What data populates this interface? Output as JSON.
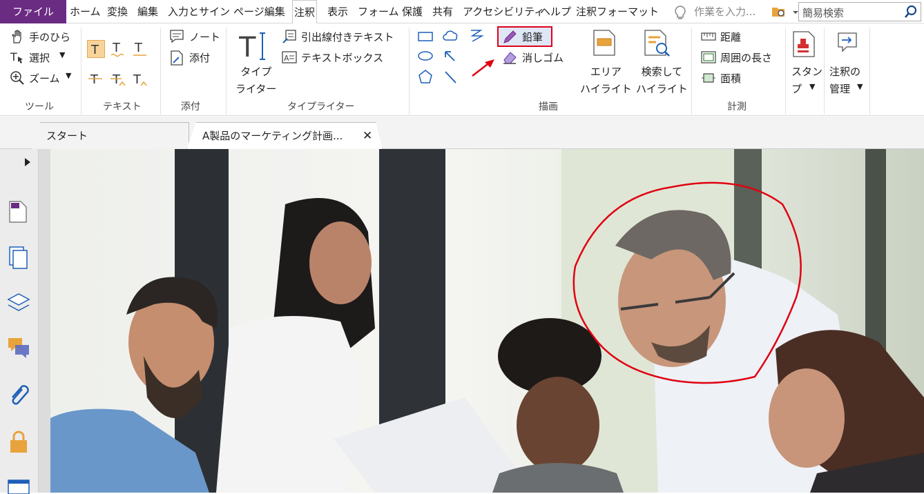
{
  "menubar": {
    "file": "ファイル",
    "tabs": [
      "ホーム",
      "変換",
      "編集",
      "入力とサイン",
      "ページ編集",
      "注釈",
      "表示",
      "フォーム",
      "保護",
      "共有",
      "アクセシビリティ",
      "ヘルプ",
      "注釈フォーマット"
    ],
    "active_tab": "注釈",
    "tell_me_placeholder": "作業を入力...",
    "search_placeholder": "簡易検索"
  },
  "ribbon": {
    "tools": {
      "hand": "手のひら",
      "select": "選択",
      "zoom": "ズーム",
      "group": "ツール"
    },
    "text": {
      "group": "テキスト"
    },
    "attach": {
      "note": "ノート",
      "attach": "添付",
      "group": "添付"
    },
    "typewriter": {
      "typewriter": "タイプ\nライター",
      "callout": "引出線付きテキスト",
      "textbox": "テキストボックス",
      "group": "タイプライター"
    },
    "drawing": {
      "pencil": "鉛筆",
      "eraser": "消しゴム",
      "area_highlight": "エリア\nハイライト",
      "search_highlight": "検索して\nハイライト",
      "group": "描画"
    },
    "measure": {
      "distance": "距離",
      "perimeter": "周囲の長さ",
      "area": "面積",
      "group": "計測"
    },
    "stamp": "スタン\nプ",
    "manage": "注釈の\n管理"
  },
  "document_tabs": [
    {
      "label": "スタート",
      "active": false
    },
    {
      "label": "A製品のマーケティング計画...",
      "active": true
    }
  ],
  "colors": {
    "file_tab": "#6a2b83",
    "highlight_box": "#e0001a",
    "pencil_annotation": "#e00010",
    "accent_icon": "#e8a33c"
  }
}
